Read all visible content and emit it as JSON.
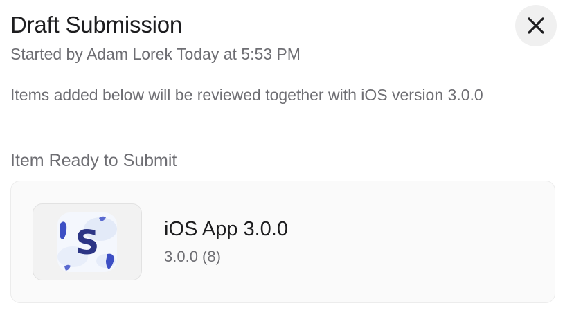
{
  "header": {
    "title": "Draft Submission",
    "subtitle": "Started by Adam Lorek Today at 5:53 PM",
    "close_icon": "close-icon"
  },
  "description": "Items added below will be reviewed together with iOS version 3.0.0",
  "section": {
    "label": "Item Ready to Submit"
  },
  "items": [
    {
      "name": "iOS App 3.0.0",
      "version": "3.0.0 (8)",
      "icon": "app-icon",
      "icon_letter": "S"
    }
  ],
  "colors": {
    "icon_accent": "#3d4fc4",
    "icon_letter": "#2c3585"
  }
}
